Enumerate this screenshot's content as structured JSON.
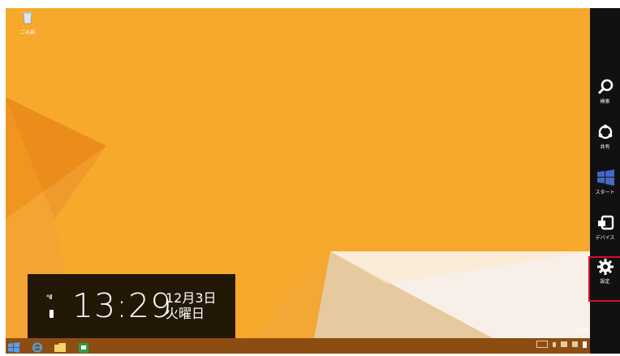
{
  "desktop": {
    "recycle_bin_label": "ごみ箱",
    "watermark": "Win",
    "background_color": "#f7a92c"
  },
  "lock_info": {
    "time": "13:29",
    "date": "12月3日",
    "weekday": "火曜日",
    "signal_label": "*ıll"
  },
  "charms": {
    "items": [
      {
        "label": "検索",
        "icon": "search-icon"
      },
      {
        "label": "共有",
        "icon": "share-icon"
      },
      {
        "label": "スタート",
        "icon": "windows-logo-icon"
      },
      {
        "label": "デバイス",
        "icon": "devices-icon"
      },
      {
        "label": "設定",
        "icon": "settings-gear-icon"
      }
    ],
    "selected_index": 4,
    "highlight_color": "#d80e26"
  },
  "taskbar": {
    "color": "#8d4d12",
    "apps": [
      "start",
      "internet-explorer",
      "file-explorer",
      "store"
    ]
  }
}
